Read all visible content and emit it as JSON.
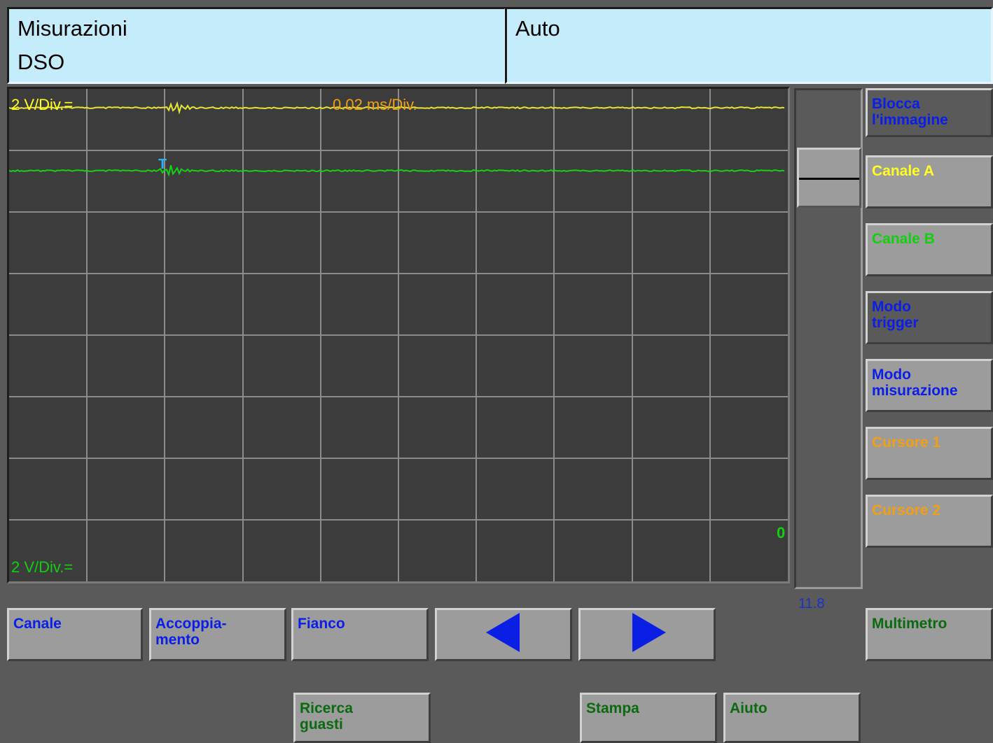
{
  "header": {
    "title": "Misurazioni",
    "subtitle": "DSO",
    "mode": "Auto"
  },
  "scope": {
    "channel_a_scale": "2 V/Div.=",
    "timebase": "0.02 ms/Div.",
    "channel_b_scale": "2 V/Div.=",
    "zero_marker": "0",
    "trigger_marker": "T",
    "colors": {
      "channel_a": "#e6e632",
      "channel_b": "#14d214",
      "timebase": "#f0a018",
      "trigger": "#28b4f0",
      "grid": "#8c8c8c"
    }
  },
  "slider": {
    "value": "11.8"
  },
  "side_buttons": [
    {
      "label": "Blocca\nl'immagine",
      "color": "#0a1ee6"
    },
    {
      "label": "Canale A",
      "color": "#ffff22"
    },
    {
      "label": "Canale B",
      "color": "#10d010"
    },
    {
      "label": "Modo\ntrigger",
      "color": "#0a1ee6"
    },
    {
      "label": "Modo\nmisurazione",
      "color": "#0a1ee6"
    },
    {
      "label": "Cursore 1",
      "color": "#f0a018"
    },
    {
      "label": "Cursore 2",
      "color": "#f0a018"
    }
  ],
  "bottom_buttons": {
    "canale": "Canale",
    "accoppiamento": "Accoppia-\nmento",
    "fianco": "Fianco",
    "prev_icon": "arrow-left-icon",
    "next_icon": "arrow-right-icon",
    "multimetro": "Multimetro",
    "ricerca_guasti": "Ricerca\nguasti",
    "stampa": "Stampa",
    "aiuto": "Aiuto"
  }
}
